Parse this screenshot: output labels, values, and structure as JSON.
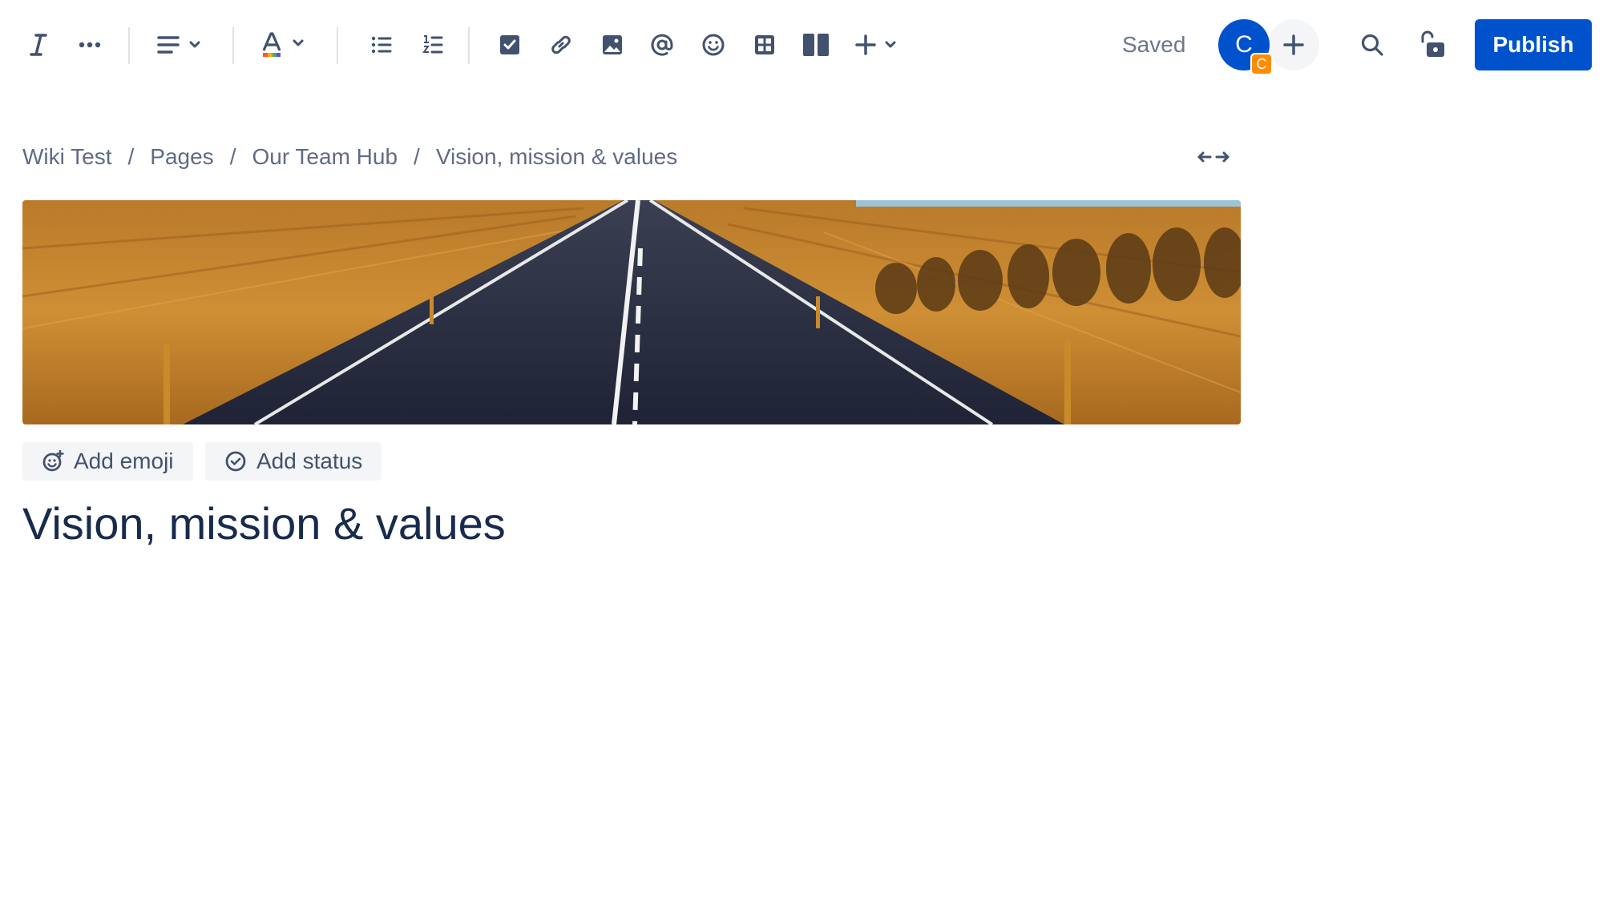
{
  "toolbar": {
    "icons": [
      "italic-icon",
      "more-icon",
      "align-icon",
      "text-color-icon",
      "bullet-list-icon",
      "numbered-list-icon",
      "task-icon",
      "link-icon",
      "image-icon",
      "mention-icon",
      "emoji-icon",
      "table-icon",
      "layouts-icon",
      "insert-icon"
    ],
    "status_text": "Saved",
    "avatar_initial": "C",
    "avatar_badge": "C",
    "publish_label": "Publish"
  },
  "breadcrumb": {
    "items": [
      "Wiki Test",
      "Pages",
      "Our Team Hub",
      "Vision, mission & values"
    ],
    "separator": "/"
  },
  "header": {
    "add_emoji_label": "Add emoji",
    "add_status_label": "Add status"
  },
  "page": {
    "title": "Vision, mission & values"
  },
  "colors": {
    "brand_blue": "#0052cc",
    "badge_orange": "#ff8b00",
    "icon_gray": "#42526e",
    "text_dark": "#172b4d"
  }
}
